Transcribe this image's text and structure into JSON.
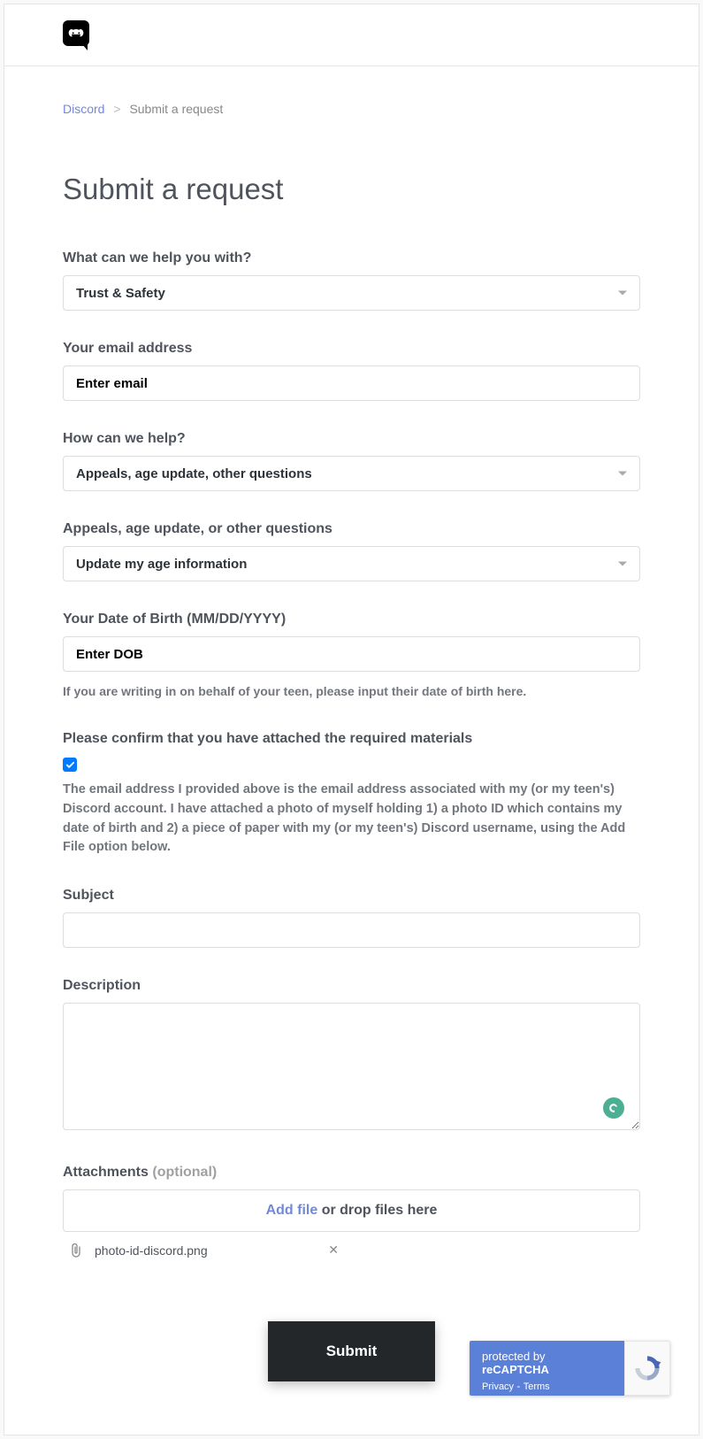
{
  "breadcrumb": {
    "home": "Discord",
    "current": "Submit a request"
  },
  "page_title": "Submit a request",
  "fields": {
    "help_with": {
      "label": "What can we help you with?",
      "value": "Trust & Safety"
    },
    "email": {
      "label": "Your email address",
      "placeholder": "Enter email",
      "value": ""
    },
    "how_help": {
      "label": "How can we help?",
      "value": "Appeals, age update, other questions"
    },
    "appeals": {
      "label": "Appeals, age update, or other questions",
      "value": "Update my age information"
    },
    "dob": {
      "label": "Your Date of Birth (MM/DD/YYYY)",
      "placeholder": "Enter DOB",
      "value": "",
      "hint": "If you are writing in on behalf of your teen, please input their date of birth here."
    },
    "confirm": {
      "label": "Please confirm that you have attached the required materials",
      "checked": true,
      "description": "The email address I provided above is the email address associated with my (or my teen's) Discord account. I have attached a photo of myself holding 1) a photo ID which contains my date of birth and 2) a piece of paper with my (or my teen's) Discord username, using the Add File option below."
    },
    "subject": {
      "label": "Subject",
      "value": ""
    },
    "description": {
      "label": "Description",
      "value": ""
    },
    "attachments": {
      "label": "Attachments",
      "optional": "(optional)",
      "add_text": "Add file",
      "drop_text": " or drop files here",
      "files": [
        {
          "name": "photo-id-discord.png"
        }
      ]
    }
  },
  "submit_label": "Submit",
  "recaptcha": {
    "protected_prefix": "protected by ",
    "protected_brand": "reCAPTCHA",
    "privacy": "Privacy",
    "sep": " - ",
    "terms": "Terms"
  }
}
